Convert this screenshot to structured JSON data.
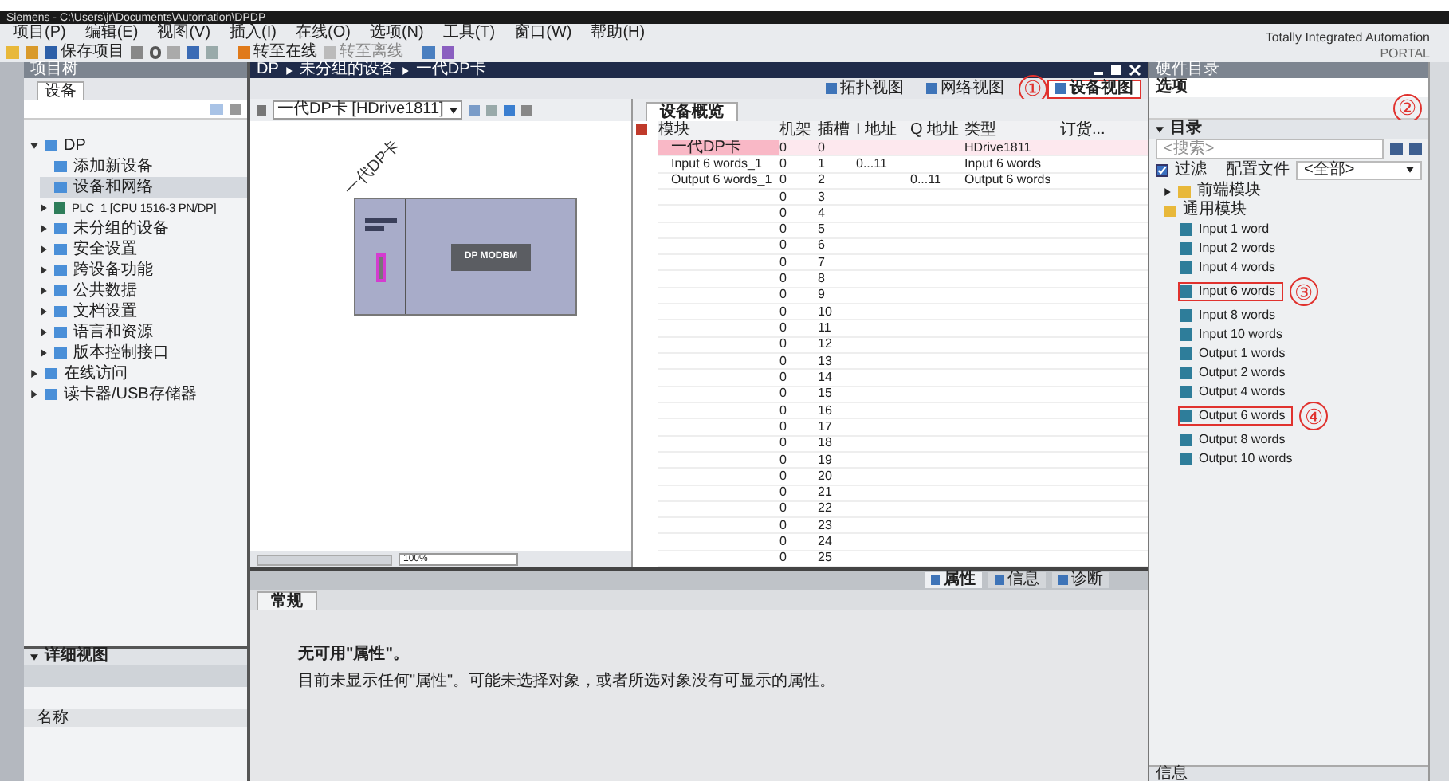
{
  "window": {
    "title": "Siemens - C:\\Users\\jr\\Documents\\Automation\\DPDP",
    "branding": [
      "Totally Integrated Automation",
      "PORTAL"
    ]
  },
  "menu": [
    "项目(P)",
    "编辑(E)",
    "视图(V)",
    "插入(I)",
    "在线(O)",
    "选项(N)",
    "工具(T)",
    "窗口(W)",
    "帮助(H)"
  ],
  "toolbar": {
    "save": "保存项目",
    "go_online": "转至在线",
    "go_offline": "转至离线"
  },
  "project_tree": {
    "title": "项目树",
    "tab": "设备",
    "items": [
      {
        "label": "DP",
        "selected": false,
        "expanded": true,
        "children": [
          {
            "label": "添加新设备",
            "selected": false
          },
          {
            "label": "设备和网络",
            "selected": true
          },
          {
            "label": "PLC_1 [CPU 1516-3 PN/DP]",
            "kind": "device",
            "selected": false,
            "expanded": false
          },
          {
            "label": "未分组的设备",
            "selected": false,
            "expanded": false
          },
          {
            "label": "安全设置",
            "selected": false,
            "expanded": false
          },
          {
            "label": "跨设备功能",
            "selected": false,
            "expanded": false
          },
          {
            "label": "公共数据",
            "selected": false,
            "expanded": false
          },
          {
            "label": "文档设置",
            "selected": false,
            "expanded": false
          },
          {
            "label": "语言和资源",
            "selected": false,
            "expanded": false
          },
          {
            "label": "版本控制接口",
            "selected": false,
            "expanded": false
          }
        ]
      },
      {
        "label": "在线访问",
        "selected": false,
        "expanded": false
      },
      {
        "label": "读卡器/USB存储器",
        "selected": false,
        "expanded": false
      }
    ],
    "details": {
      "title": "详细视图",
      "column": "名称"
    }
  },
  "editor": {
    "breadcrumb": [
      "DP",
      "未分组的设备",
      "一代DP卡"
    ],
    "views": [
      {
        "label": "拓扑视图",
        "selected": false,
        "highlighted": false
      },
      {
        "label": "网络视图",
        "selected": false,
        "highlighted": false
      },
      {
        "label": "设备视图",
        "selected": true,
        "highlighted": true,
        "marker": "①"
      }
    ],
    "device_select": "一代DP卡 [HDrive1811]",
    "device_label": "一代DP卡",
    "module_label": "DP MODBM",
    "zoom": "100%"
  },
  "overview": {
    "tab": "设备概览",
    "columns": [
      "模块",
      "机架",
      "插槽",
      "I 地址",
      "Q 地址",
      "类型",
      "订货..."
    ],
    "rows": [
      {
        "module": "一代DP卡",
        "rack": "0",
        "slot": "0",
        "type": "HDrive1811",
        "selected": true
      },
      {
        "module": "Input 6 words_1",
        "rack": "0",
        "slot": "1",
        "i_address": "0...11",
        "type": "Input 6 words",
        "selected": false
      },
      {
        "module": "Output 6 words_1",
        "rack": "0",
        "slot": "2",
        "q_address": "0...11",
        "type": "Output 6 words",
        "selected": false
      },
      {
        "rack": "0",
        "slot": "3",
        "selected": false
      },
      {
        "rack": "0",
        "slot": "4",
        "selected": false
      },
      {
        "rack": "0",
        "slot": "5",
        "selected": false
      },
      {
        "rack": "0",
        "slot": "6",
        "selected": false
      },
      {
        "rack": "0",
        "slot": "7",
        "selected": false
      },
      {
        "rack": "0",
        "slot": "8",
        "selected": false
      },
      {
        "rack": "0",
        "slot": "9",
        "selected": false
      },
      {
        "rack": "0",
        "slot": "10",
        "selected": false
      },
      {
        "rack": "0",
        "slot": "11",
        "selected": false
      },
      {
        "rack": "0",
        "slot": "12",
        "selected": false
      },
      {
        "rack": "0",
        "slot": "13",
        "selected": false
      },
      {
        "rack": "0",
        "slot": "14",
        "selected": false
      },
      {
        "rack": "0",
        "slot": "15",
        "selected": false
      },
      {
        "rack": "0",
        "slot": "16",
        "selected": false
      },
      {
        "rack": "0",
        "slot": "17",
        "selected": false
      },
      {
        "rack": "0",
        "slot": "18",
        "selected": false
      },
      {
        "rack": "0",
        "slot": "19",
        "selected": false
      },
      {
        "rack": "0",
        "slot": "20",
        "selected": false
      },
      {
        "rack": "0",
        "slot": "21",
        "selected": false
      },
      {
        "rack": "0",
        "slot": "22",
        "selected": false
      },
      {
        "rack": "0",
        "slot": "23",
        "selected": false
      },
      {
        "rack": "0",
        "slot": "24",
        "selected": false
      },
      {
        "rack": "0",
        "slot": "25",
        "selected": false
      }
    ]
  },
  "inspector": {
    "tabs": [
      {
        "label": "属性",
        "selected": true
      },
      {
        "label": "信息",
        "selected": false
      },
      {
        "label": "诊断",
        "selected": false
      }
    ],
    "subtab": "常规",
    "heading": "无可用\"属性\"。",
    "message": "目前未显示任何\"属性\"。可能未选择对象，或者所选对象没有可显示的属性。"
  },
  "catalog": {
    "title": "硬件目录",
    "options": "选项",
    "marker": "②",
    "section": "目录",
    "search_placeholder": "<搜索>",
    "filter": {
      "label": "过滤",
      "checked": true
    },
    "profile_label": "配置文件",
    "profile_value": "<全部>",
    "items": [
      {
        "label": "前端模块",
        "kind": "folder",
        "selected": false,
        "expanded": false,
        "highlighted": false
      },
      {
        "label": "通用模块",
        "kind": "folder",
        "selected": false,
        "highlighted": false
      },
      {
        "label": "Input 1 word",
        "kind": "module",
        "selected": false,
        "highlighted": false
      },
      {
        "label": "Input 2 words",
        "kind": "module",
        "selected": false,
        "highlighted": false
      },
      {
        "label": "Input 4 words",
        "kind": "module",
        "selected": false,
        "highlighted": false
      },
      {
        "label": "Input 6 words",
        "kind": "module",
        "selected": false,
        "highlighted": true,
        "marker": "③"
      },
      {
        "label": "Input 8 words",
        "kind": "module",
        "selected": false,
        "highlighted": false
      },
      {
        "label": "Input 10 words",
        "kind": "module",
        "selected": false,
        "highlighted": false
      },
      {
        "label": "Output 1 words",
        "kind": "module",
        "selected": false,
        "highlighted": false
      },
      {
        "label": "Output 2 words",
        "kind": "module",
        "selected": false,
        "highlighted": false
      },
      {
        "label": "Output 4 words",
        "kind": "module",
        "selected": false,
        "highlighted": false
      },
      {
        "label": "Output 6 words",
        "kind": "module",
        "selected": false,
        "highlighted": true,
        "marker": "④"
      },
      {
        "label": "Output 8 words",
        "kind": "module",
        "selected": false,
        "highlighted": false
      },
      {
        "label": "Output 10 words",
        "kind": "module",
        "selected": false,
        "highlighted": false
      }
    ],
    "info": "信息"
  }
}
